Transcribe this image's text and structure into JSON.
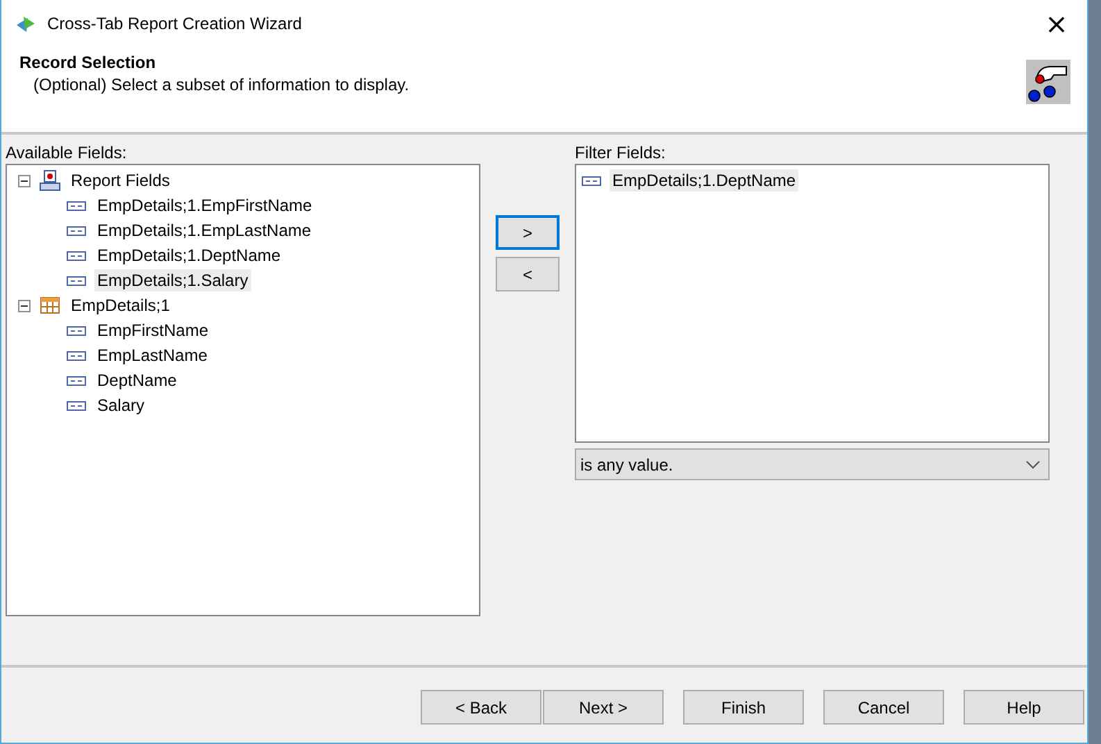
{
  "window": {
    "title": "Cross-Tab Report Creation Wizard",
    "close": "×"
  },
  "header": {
    "title": "Record Selection",
    "subtitle": "(Optional)  Select a subset of information to display."
  },
  "available_fields": {
    "label": "Available Fields:",
    "tree": [
      {
        "kind": "report",
        "label": "Report Fields",
        "expanded": true,
        "selected": false,
        "children": [
          {
            "label": "EmpDetails;1.EmpFirstName",
            "selected": false
          },
          {
            "label": "EmpDetails;1.EmpLastName",
            "selected": false
          },
          {
            "label": "EmpDetails;1.DeptName",
            "selected": false
          },
          {
            "label": "EmpDetails;1.Salary",
            "selected": true
          }
        ]
      },
      {
        "kind": "table",
        "label": "EmpDetails;1",
        "expanded": true,
        "selected": false,
        "children": [
          {
            "label": "EmpFirstName",
            "selected": false
          },
          {
            "label": "EmpLastName",
            "selected": false
          },
          {
            "label": "DeptName",
            "selected": false
          },
          {
            "label": "Salary",
            "selected": false
          }
        ]
      }
    ]
  },
  "move_buttons": [
    {
      "label": ">",
      "focused": true
    },
    {
      "label": "<",
      "focused": false
    }
  ],
  "filter_fields": {
    "label": "Filter Fields:",
    "items": [
      {
        "label": "EmpDetails;1.DeptName",
        "selected": true
      }
    ],
    "condition": "is any value."
  },
  "buttons": [
    "< Back",
    "Next >",
    "Finish",
    "Cancel",
    "Help"
  ]
}
